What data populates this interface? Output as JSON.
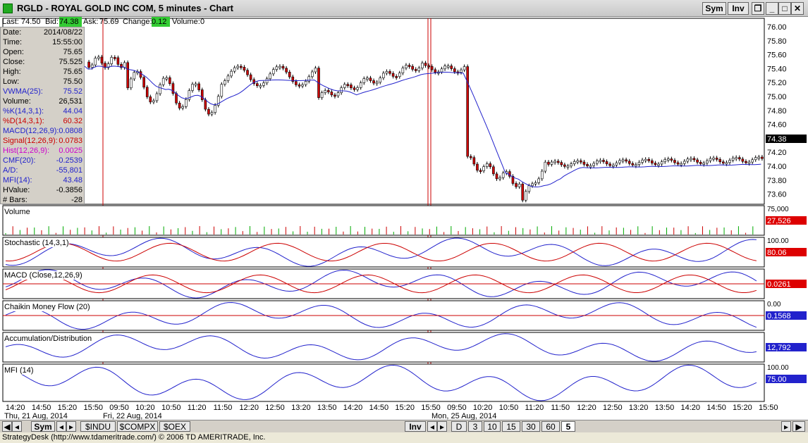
{
  "window": {
    "title": "RGLD - ROYAL GOLD INC COM, 5 minutes - Chart",
    "sym_label": "Sym",
    "inv_label": "Inv"
  },
  "quote": {
    "last_label": "Last:",
    "last": "74.50",
    "bid_label": "Bid:",
    "bid": "74.38",
    "ask_label": "Ask:",
    "ask": "75.69",
    "change_label": "Change:",
    "change": "0.12",
    "volume_label": "Volume:",
    "volume": "0"
  },
  "info": [
    {
      "k": "Date:",
      "v": "2014/08/22",
      "color": "#000000"
    },
    {
      "k": "Time:",
      "v": "15:55:00",
      "color": "#000000"
    },
    {
      "k": "Open:",
      "v": "75.65",
      "color": "#000000"
    },
    {
      "k": "Close:",
      "v": "75.525",
      "color": "#000000"
    },
    {
      "k": "High:",
      "v": "75.65",
      "color": "#000000"
    },
    {
      "k": "Low:",
      "v": "75.50",
      "color": "#000000"
    },
    {
      "k": "VWMA(25):",
      "v": "75.52",
      "color": "#2222cc"
    },
    {
      "k": "Volume:",
      "v": "26,531",
      "color": "#000000"
    },
    {
      "k": "%K(14,3,1):",
      "v": "44.04",
      "color": "#2222cc"
    },
    {
      "k": "%D(14,3,1):",
      "v": "60.32",
      "color": "#cc0000"
    },
    {
      "k": "MACD(12,26,9):",
      "v": "0.0808",
      "color": "#2222cc"
    },
    {
      "k": "Signal(12,26,9):",
      "v": "0.0783",
      "color": "#cc0000"
    },
    {
      "k": "Hist(12,26,9):",
      "v": "0.0025",
      "color": "#cc00cc"
    },
    {
      "k": "CMF(20):",
      "v": "-0.2539",
      "color": "#2222cc"
    },
    {
      "k": "A/D:",
      "v": "-55,801",
      "color": "#2222cc"
    },
    {
      "k": "MFI(14):",
      "v": "43.48",
      "color": "#2222cc"
    },
    {
      "k": "HValue:",
      "v": "-0.3856",
      "color": "#000000"
    },
    {
      "k": "# Bars:",
      "v": "-28",
      "color": "#000000"
    }
  ],
  "price_axis": [
    "76.00",
    "75.80",
    "75.60",
    "75.40",
    "75.20",
    "75.00",
    "74.80",
    "74.60",
    "74.40",
    "74.20",
    "74.00",
    "73.80",
    "73.60"
  ],
  "last_price_tag": "74.38",
  "panels": {
    "volume": {
      "label": "Volume",
      "axis_top": "75,000",
      "value_tag": "27,526"
    },
    "stochastic": {
      "label": "Stochastic (14,3,1)",
      "axis_top": "100.00",
      "value_tag": "80.06"
    },
    "macd": {
      "label": "MACD (Close,12,26,9)",
      "value_tag": "0.0261"
    },
    "cmf": {
      "label": "Chaikin Money Flow (20)",
      "axis_top": "0.00",
      "value_tag": "0.1568"
    },
    "ad": {
      "label": "Accumulation/Distribution",
      "value_tag": "12,792"
    },
    "mfi": {
      "label": "MFI (14)",
      "axis_top": "100.00",
      "value_tag": "75.00"
    }
  },
  "time_axis": {
    "ticks": [
      "14:20",
      "14:50",
      "15:20",
      "15:50",
      "09:50",
      "10:20",
      "10:50",
      "11:20",
      "11:50",
      "12:20",
      "12:50",
      "13:20",
      "13:50",
      "14:20",
      "14:50",
      "15:20",
      "15:50",
      "09:50",
      "10:20",
      "10:50",
      "11:20",
      "11:50",
      "12:20",
      "12:50",
      "13:20",
      "13:50",
      "14:20",
      "14:50",
      "15:20",
      "15:50"
    ],
    "dates": [
      "Thu, 21 Aug, 2014",
      "Fri, 22 Aug, 2014",
      "Mon, 25 Aug, 2014"
    ]
  },
  "bottom_bar": {
    "sym": "Sym",
    "tabs": [
      "$INDU",
      "$COMPX",
      "$OEX"
    ],
    "inv": "Inv",
    "periods": [
      "D",
      "3",
      "10",
      "15",
      "30",
      "60",
      "5"
    ]
  },
  "status": "StrategyDesk (http://www.tdameritrade.com/) © 2006 TD AMERITRADE, Inc.",
  "colors": {
    "up": "#ffffff",
    "down": "#cc0000",
    "line_blue": "#2222cc",
    "line_red": "#cc0000",
    "accent_green": "#33cc33"
  }
}
